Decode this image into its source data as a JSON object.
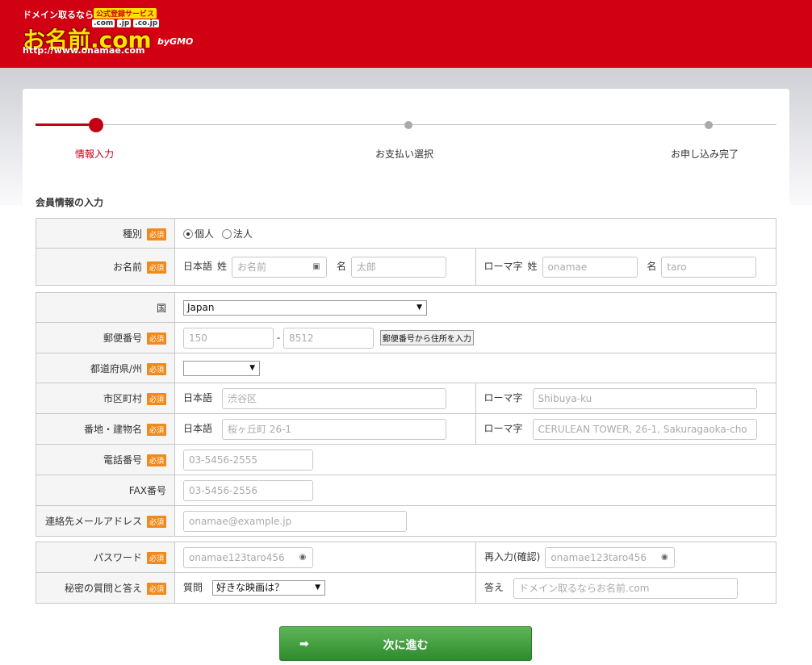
{
  "logo": {
    "tagline": "ドメイン取るなら",
    "badge": "公式登録サービス",
    "tlds": [
      ".com",
      ".jp",
      ".co.jp"
    ],
    "brand": "お名前.com",
    "by": "byGMO",
    "url": "http://www.onamae.com"
  },
  "steps": [
    "情報入力",
    "お支払い選択",
    "お申し込み完了"
  ],
  "section_title": "会員情報の入力",
  "required_badge": "必須",
  "member_type": {
    "label": "種別",
    "options": [
      "個人",
      "法人"
    ],
    "selected": "個人"
  },
  "name": {
    "label": "お名前",
    "ja_label": "日本語",
    "sei": "姓",
    "mei": "名",
    "sei_placeholder": "お名前",
    "mei_placeholder": "太郎",
    "roma_label": "ローマ字",
    "roma_sei_placeholder": "onamae",
    "roma_mei_placeholder": "taro"
  },
  "country": {
    "label": "国",
    "value": "Japan"
  },
  "postal": {
    "label": "郵便番号",
    "part1_placeholder": "150",
    "sep": "-",
    "part2_placeholder": "8512",
    "lookup_button": "郵便番号から住所を入力"
  },
  "prefecture": {
    "label": "都道府県/州",
    "value": ""
  },
  "city": {
    "label": "市区町村",
    "ja_label": "日本語",
    "ja_placeholder": "渋谷区",
    "roma_label": "ローマ字",
    "roma_placeholder": "Shibuya-ku"
  },
  "street": {
    "label": "番地・建物名",
    "ja_label": "日本語",
    "ja_placeholder": "桜ヶ丘町 26-1",
    "roma_label": "ローマ字",
    "roma_placeholder": "CERULEAN TOWER, 26-1, Sakuragaoka-cho"
  },
  "phone": {
    "label": "電話番号",
    "placeholder": "03-5456-2555"
  },
  "fax": {
    "label": "FAX番号",
    "placeholder": "03-5456-2556"
  },
  "email": {
    "label": "連絡先メールアドレス",
    "placeholder": "onamae@example.jp"
  },
  "password": {
    "label": "パスワード",
    "placeholder": "onamae123taro456",
    "confirm_label": "再入力(確認)",
    "confirm_placeholder": "onamae123taro456"
  },
  "secret": {
    "label": "秘密の質問と答え",
    "question_label": "質問",
    "question_value": "好きな映画は？",
    "answer_label": "答え",
    "answer_placeholder": "ドメイン取るならお名前.com"
  },
  "next_button": "次に進む",
  "colors": {
    "header": "#d10012",
    "accent": "#c40014",
    "required": "#f08a1c",
    "button": "#3d9a3a"
  }
}
